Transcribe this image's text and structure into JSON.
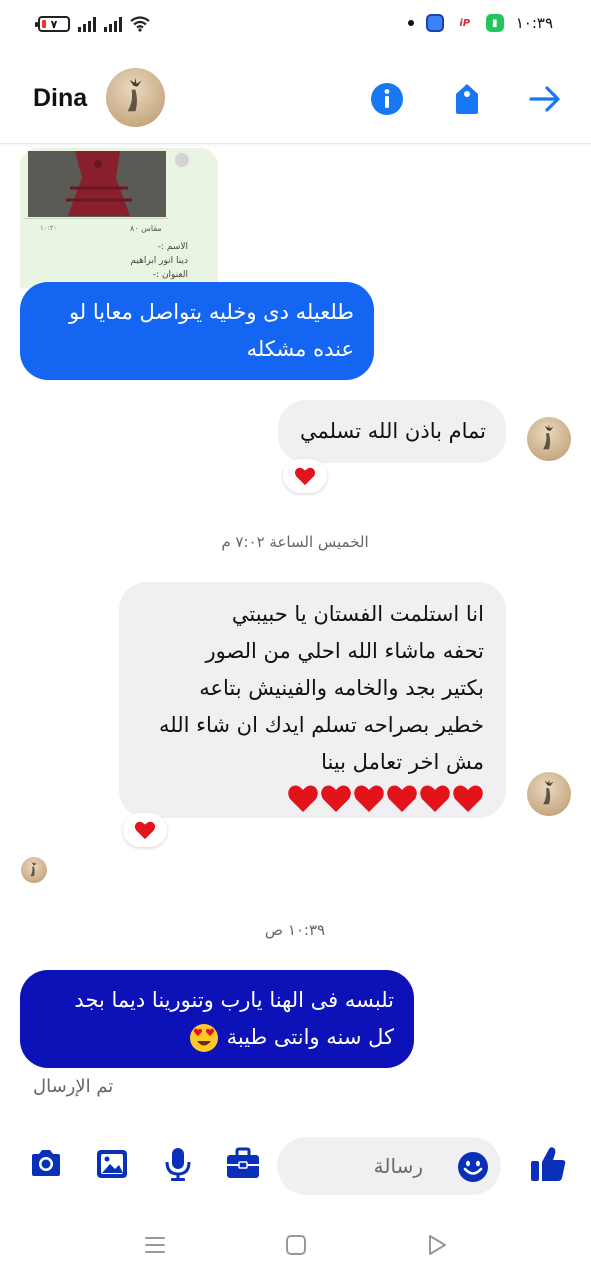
{
  "status_bar": {
    "battery_text": "٧",
    "time": "١٠:٣٩"
  },
  "header": {
    "contact_name": "Dina",
    "accent_color": "#1877f2",
    "icons": [
      "info-icon",
      "tag-icon",
      "forward-arrow-icon"
    ]
  },
  "attachment_preview": {
    "size_text": "مقاس ٨٠",
    "time_text": "١٠:٢٠",
    "line1": "الاسم :-",
    "line2": "دينا انور ابراهيم",
    "line3": "العنوان :-"
  },
  "messages": {
    "m1": {
      "lines": [
        "طلعيله دى وخليه يتواصل معايا لو",
        "عنده مشكله"
      ]
    },
    "m2": {
      "text": "تمام باذن الله تسلمي"
    },
    "timestamp1": "الخميس الساعة ٧:٠٢ م",
    "m3": {
      "lines": [
        "انا استلمت الفستان يا حبيبتي",
        "تحفه ماشاء الله احلي من الصور",
        "بكتير بجد والخامه والفينيش بتاعه",
        "خطير بصراحه تسلم ايدك ان شاء الله",
        "مش اخر تعامل بينا"
      ],
      "hearts": 6
    },
    "timestamp2": "١٠:٣٩ ص",
    "m4": {
      "lines": [
        "تلبسه فى الهنا يارب وتنورينا ديما بجد",
        "كل سنه وانتى طيبة"
      ]
    },
    "status": "تم الإرسال"
  },
  "composer": {
    "placeholder": "رسالة",
    "icons": [
      "camera-icon",
      "image-icon",
      "mic-icon",
      "briefcase-icon",
      "emoji-icon",
      "thumbs-up-icon"
    ]
  },
  "colors": {
    "blue_bubble": "#1565f3",
    "navy_bubble": "#0d12b8",
    "grey_bubble": "#f0f0f3",
    "composer_icon": "#0a2fb8"
  }
}
